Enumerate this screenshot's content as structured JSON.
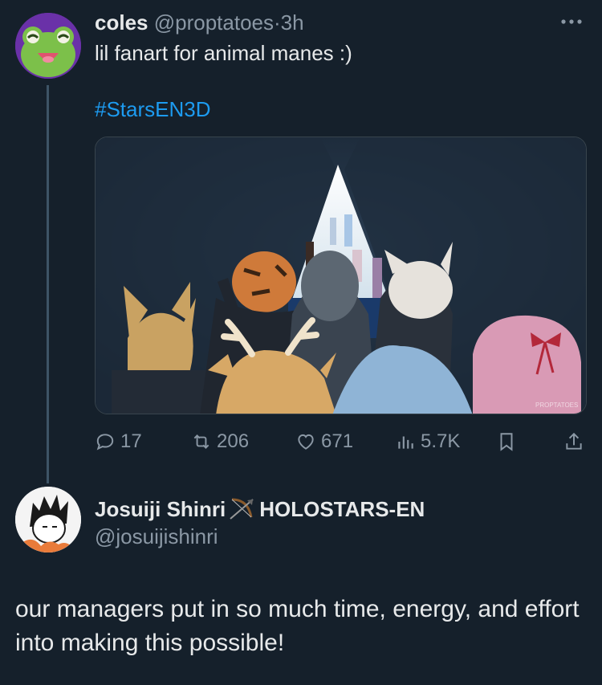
{
  "tweet": {
    "display_name": "coles",
    "handle": "@proptatoes",
    "separator": "·",
    "time": "3h",
    "text": "lil fanart for animal manes :)",
    "hashtag": "#StarsEN3D",
    "signature": "PROPTATOES",
    "actions": {
      "replies": "17",
      "retweets": "206",
      "likes": "671",
      "views": "5.7K"
    }
  },
  "reply": {
    "display_name_a": "Josuiji Shinri",
    "display_name_b": "HOLOSTARS-EN",
    "handle": "@josuijishinri",
    "text": "our managers put in so much time, energy, and effort into making this possible!"
  },
  "icons": {
    "more": "more-horizontal-icon",
    "reply": "reply-icon",
    "retweet": "retweet-icon",
    "like": "heart-icon",
    "views": "views-icon",
    "bookmark": "bookmark-icon",
    "share": "share-icon",
    "bow": "bow-arrow-emoji-icon"
  },
  "colors": {
    "background": "#15202b",
    "link": "#1d9bf0",
    "muted": "#8b98a5"
  }
}
